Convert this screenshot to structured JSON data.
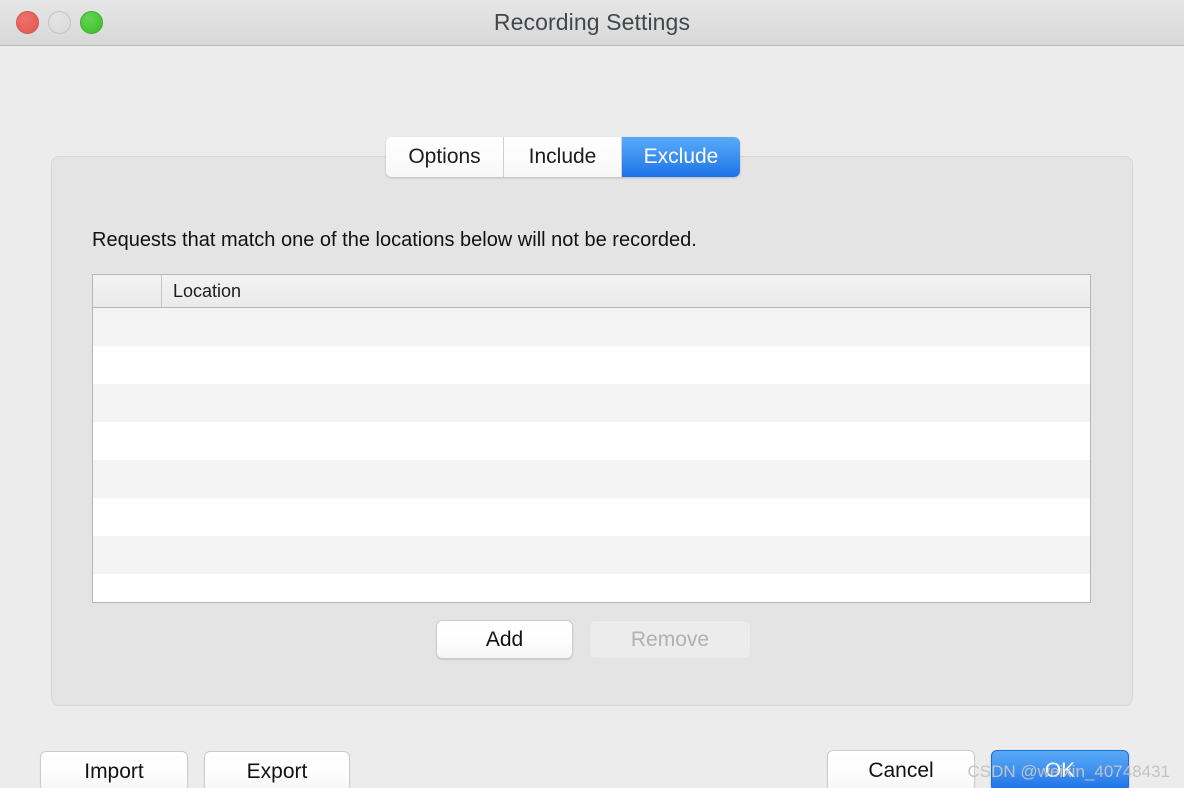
{
  "window": {
    "title": "Recording Settings",
    "controls": {
      "close": "close-button",
      "minimize": "minimize-button",
      "maximize": "maximize-button"
    }
  },
  "tabs": [
    {
      "label": "Options",
      "selected": false
    },
    {
      "label": "Include",
      "selected": false
    },
    {
      "label": "Exclude",
      "selected": true
    }
  ],
  "panel": {
    "description": "Requests that match one of the locations below will not be recorded.",
    "table": {
      "columns": [
        "",
        "Location"
      ],
      "rows": [],
      "empty_row_count": 8
    },
    "list_buttons": {
      "add_label": "Add",
      "remove_label": "Remove",
      "remove_disabled": true
    }
  },
  "footer": {
    "import_label": "Import",
    "export_label": "Export",
    "cancel_label": "Cancel",
    "ok_label": "OK"
  },
  "watermark": "CSDN @weixin_40748431",
  "colors": {
    "accent": "#3d90f0",
    "window_bg": "#ececec",
    "panel_bg": "#e4e4e4",
    "row_alt": "#f4f4f4",
    "close": "#e45f57",
    "minimize": "#dcdcdc",
    "maximize": "#47c337"
  }
}
